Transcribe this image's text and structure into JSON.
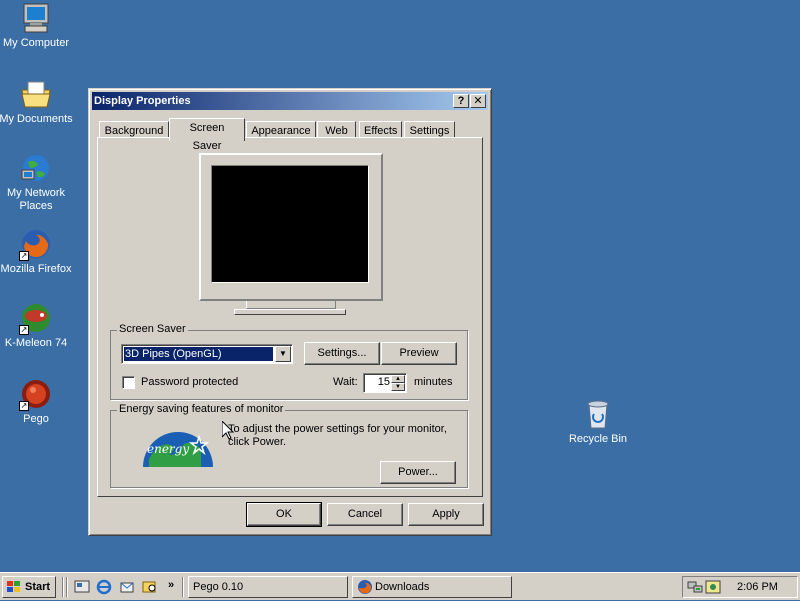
{
  "desktop": {
    "icons": [
      {
        "label": "My Computer",
        "icon": "computer-icon"
      },
      {
        "label": "My Documents",
        "icon": "folder-documents-icon"
      },
      {
        "label": "My Network Places",
        "icon": "network-places-icon"
      },
      {
        "label": "Mozilla Firefox",
        "icon": "firefox-icon"
      },
      {
        "label": "K-Meleon 74",
        "icon": "k-meleon-icon"
      },
      {
        "label": "Pego",
        "icon": "pego-icon"
      },
      {
        "label": "Recycle Bin",
        "icon": "recycle-bin-icon"
      }
    ]
  },
  "window": {
    "title": "Display Properties",
    "help_button": "?",
    "close_button": "✕",
    "tabs": [
      {
        "label": "Background"
      },
      {
        "label": "Screen Saver"
      },
      {
        "label": "Appearance"
      },
      {
        "label": "Web"
      },
      {
        "label": "Effects"
      },
      {
        "label": "Settings"
      }
    ],
    "active_tab": "Screen Saver",
    "screensaver": {
      "group_label": "Screen Saver",
      "selected": "3D Pipes (OpenGL)",
      "settings_button": "Settings...",
      "preview_button": "Preview",
      "password_label": "Password protected",
      "password_checked": false,
      "wait_label": "Wait:",
      "wait_value": "15",
      "wait_unit": "minutes"
    },
    "energy": {
      "group_label": "Energy saving features of monitor",
      "description": "To adjust the power settings for your monitor, click Power.",
      "power_button": "Power...",
      "logo_text": "energy"
    },
    "buttons": {
      "ok": "OK",
      "cancel": "Cancel",
      "apply": "Apply"
    }
  },
  "taskbar": {
    "start_label": "Start",
    "tasks": [
      {
        "label": "Pego 0.10"
      },
      {
        "label": "Downloads"
      }
    ],
    "clock": "2:06 PM"
  },
  "colors": {
    "desktop": "#3a6ea5",
    "title_start": "#0a246a",
    "title_end": "#a6caf0",
    "face": "#d4d0c8",
    "selection": "#0a246a"
  }
}
